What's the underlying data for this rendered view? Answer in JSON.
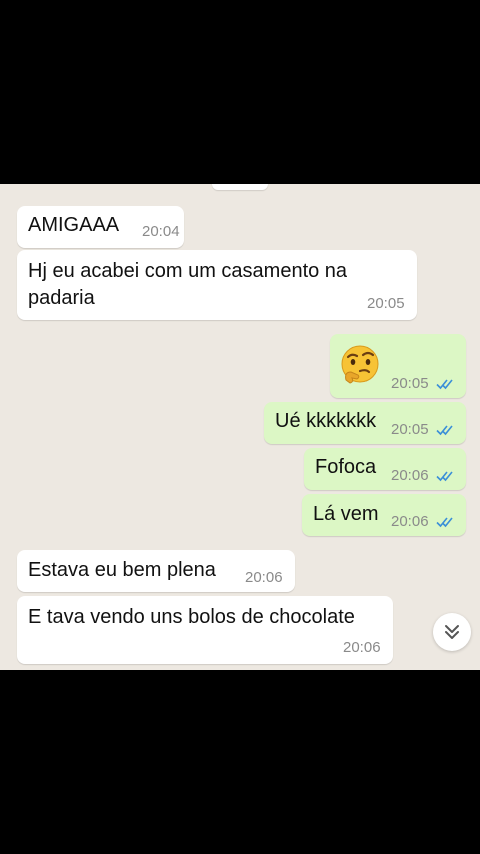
{
  "messages": [
    {
      "text": "AMIGAAA",
      "time": "20:04"
    },
    {
      "text_line1": "Hj eu acabei com um casamento na",
      "text_line2": "padaria",
      "time": "20:05"
    },
    {
      "emoji": "thinking-face-emoji",
      "time": "20:05"
    },
    {
      "text": "Ué kkkkkkk",
      "time": "20:05"
    },
    {
      "text": "Fofoca",
      "time": "20:06"
    },
    {
      "text": "Lá vem",
      "time": "20:06"
    },
    {
      "text": "Estava eu bem plena",
      "time": "20:06"
    },
    {
      "text": "E tava vendo uns bolos de chocolate",
      "time": "20:06"
    }
  ],
  "colors": {
    "incoming_bubble": "#ffffff",
    "outgoing_bubble": "#dcf7c5",
    "chat_background": "#ede8e1",
    "read_ticks": "#3b8fd8"
  },
  "icons": {
    "read_receipt": "double-check-icon",
    "scroll_down": "double-chevron-down-icon"
  }
}
